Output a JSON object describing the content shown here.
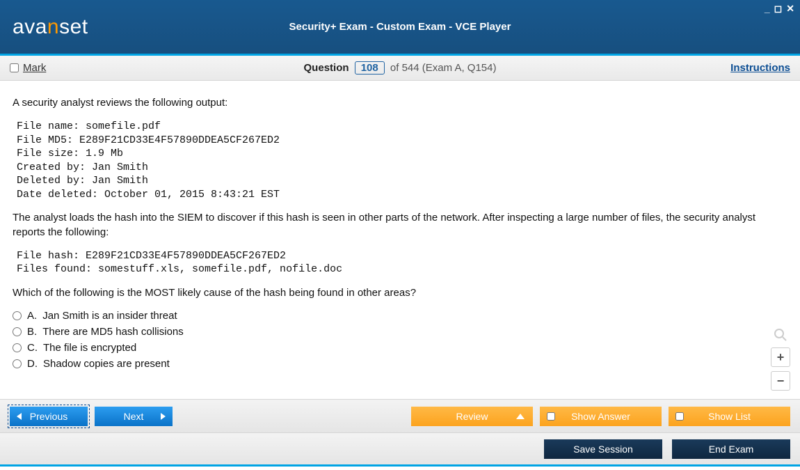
{
  "window": {
    "title": "Security+ Exam - Custom Exam - VCE Player",
    "logo_parts": {
      "a1": "a",
      "v": "v",
      "a2": "a",
      "n": "n",
      "set": "set"
    }
  },
  "subheader": {
    "mark_label": "Mark",
    "question_label": "Question",
    "current_number": "108",
    "of_total": " of 544 (Exam A, Q154)",
    "instructions": "Instructions"
  },
  "question": {
    "intro": "A security analyst reviews the following output:",
    "block1": "File name: somefile.pdf\nFile MD5: E289F21CD33E4F57890DDEA5CF267ED2\nFile size: 1.9 Mb\nCreated by: Jan Smith\nDeleted by: Jan Smith\nDate deleted: October 01, 2015 8:43:21 EST",
    "middle": "The analyst loads the hash into the SIEM to discover if this hash is seen in other parts of the network. After inspecting a large number of files, the security analyst reports the following:",
    "block2": "File hash: E289F21CD33E4F57890DDEA5CF267ED2\nFiles found: somestuff.xls, somefile.pdf, nofile.doc",
    "prompt": "Which of the following is the MOST likely cause of the hash being found in other areas?",
    "options": [
      {
        "letter": "A.",
        "text": "Jan Smith is an insider threat"
      },
      {
        "letter": "B.",
        "text": "There are MD5 hash collisions"
      },
      {
        "letter": "C.",
        "text": "The file is encrypted"
      },
      {
        "letter": "D.",
        "text": "Shadow copies are present"
      }
    ]
  },
  "buttons": {
    "previous": "Previous",
    "next": "Next",
    "review": "Review",
    "show_answer": "Show Answer",
    "show_list": "Show List",
    "save_session": "Save Session",
    "end_exam": "End Exam"
  }
}
